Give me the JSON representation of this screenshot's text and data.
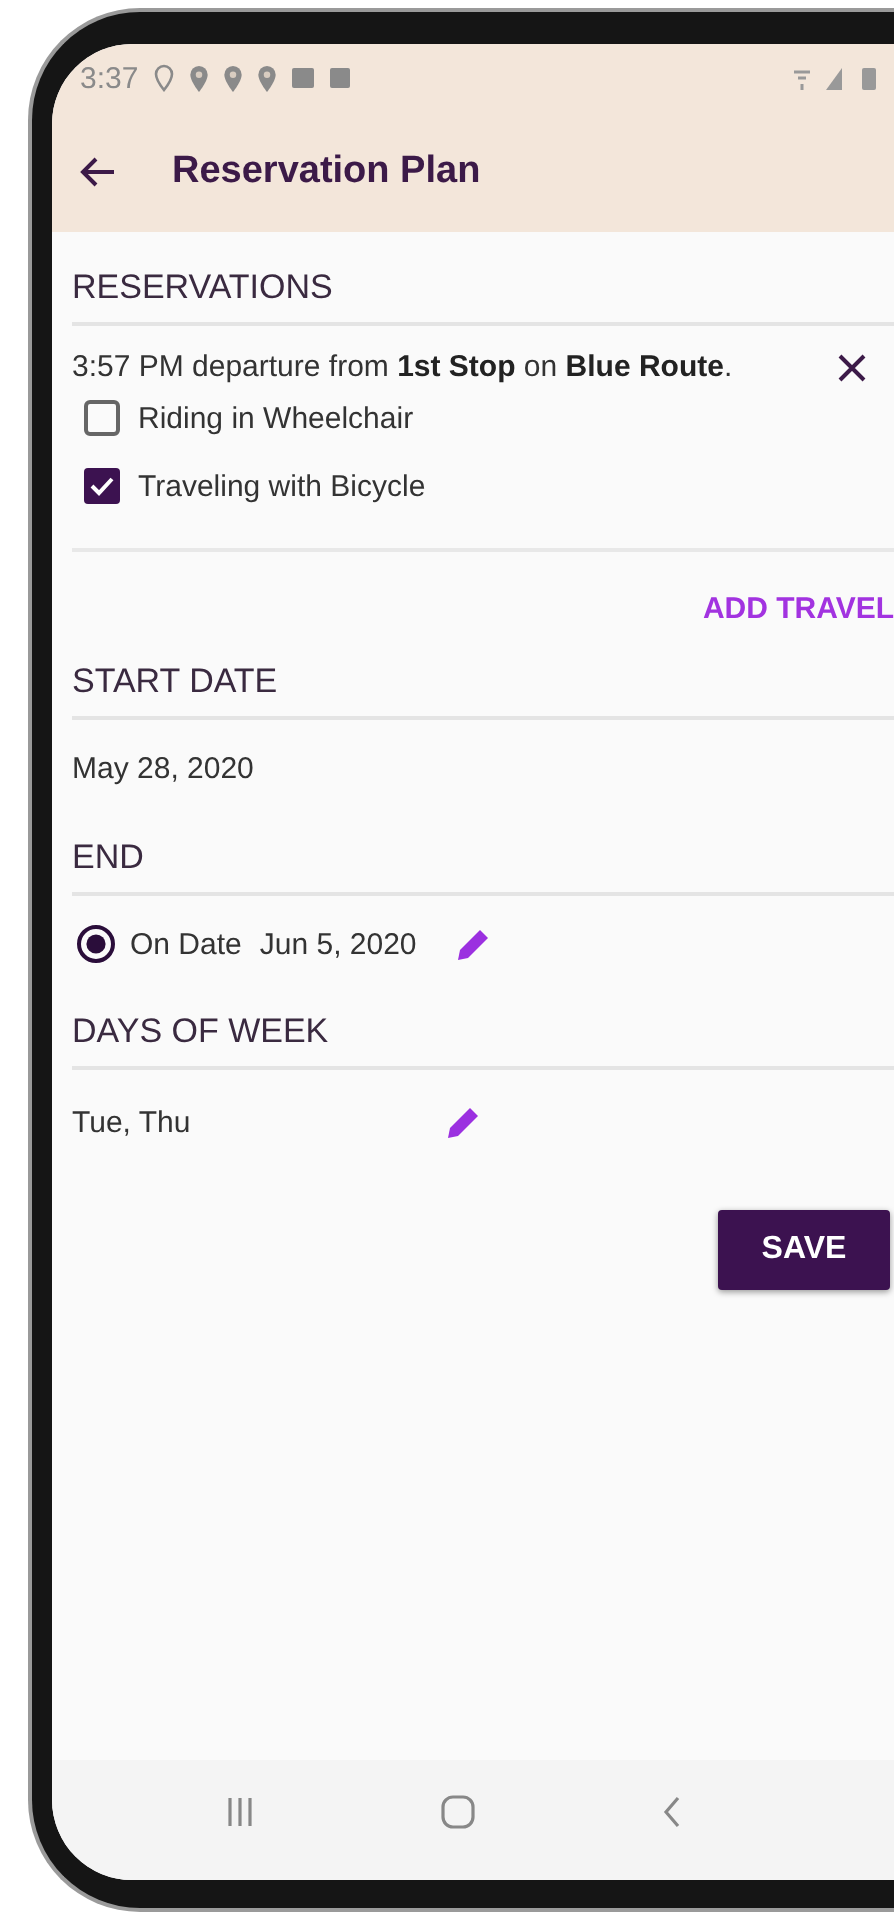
{
  "status_bar": {
    "time": "3:37"
  },
  "app_bar": {
    "title": "Reservation Plan"
  },
  "reservations": {
    "heading": "RESERVATIONS",
    "items": [
      {
        "text": "3:57 PM departure from **1st Stop** on **Blue Route**.",
        "options": [
          {
            "label": "Riding in Wheelchair",
            "checked": false
          },
          {
            "label": "Traveling with Bicycle",
            "checked": true
          }
        ]
      }
    ],
    "add_button": "ADD TRAVEL"
  },
  "start_date": {
    "heading": "START DATE",
    "value": "May 28, 2020"
  },
  "end": {
    "heading": "END",
    "options": [
      {
        "label": "On Date",
        "value": "Jun 5, 2020",
        "selected": true
      }
    ]
  },
  "days_of_week": {
    "heading": "DAYS OF WEEK",
    "value": "Tue, Thu"
  },
  "save_button": "SAVE"
}
